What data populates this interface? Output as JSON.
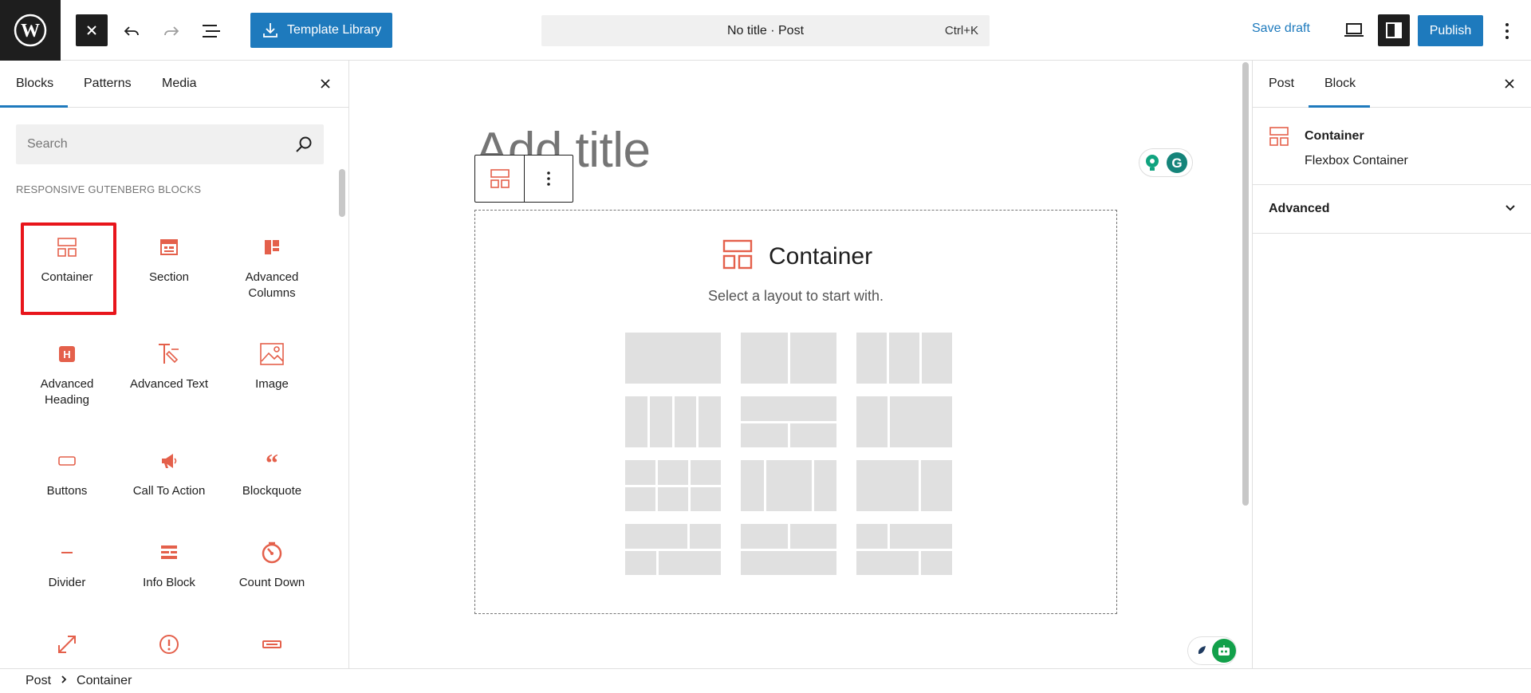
{
  "topbar": {
    "logo_icon": "wordpress-icon",
    "close_icon": "close-icon",
    "undo_icon": "undo-icon",
    "redo_icon": "redo-icon",
    "document_overview_icon": "list-view-icon",
    "template_library_label": "Template Library",
    "command_title": "No title · Post",
    "command_shortcut": "Ctrl+K",
    "save_draft_label": "Save draft",
    "preview_icon": "laptop-icon",
    "settings_icon": "sidebar-toggle-icon",
    "publish_label": "Publish",
    "options_icon": "more-vertical-icon",
    "accent_color": "#1e7abd"
  },
  "inserter": {
    "tabs": [
      {
        "label": "Blocks",
        "active": true
      },
      {
        "label": "Patterns",
        "active": false
      },
      {
        "label": "Media",
        "active": false
      }
    ],
    "search_placeholder": "Search",
    "category_title": "RESPONSIVE GUTENBERG BLOCKS",
    "icon_color": "#e4604b",
    "highlight_color": "#e8151b",
    "blocks": [
      {
        "label": "Container",
        "icon": "container-icon"
      },
      {
        "label": "Section",
        "icon": "section-icon"
      },
      {
        "label": "Advanced Columns",
        "icon": "columns-icon"
      },
      {
        "label": "Advanced Heading",
        "icon": "heading-icon"
      },
      {
        "label": "Advanced Text",
        "icon": "text-icon"
      },
      {
        "label": "Image",
        "icon": "image-icon"
      },
      {
        "label": "Buttons",
        "icon": "button-icon"
      },
      {
        "label": "Call To Action",
        "icon": "megaphone-icon"
      },
      {
        "label": "Blockquote",
        "icon": "quote-icon"
      },
      {
        "label": "Divider",
        "icon": "divider-icon"
      },
      {
        "label": "Info Block",
        "icon": "info-block-icon"
      },
      {
        "label": "Count Down",
        "icon": "countdown-icon"
      },
      {
        "label": "",
        "icon": "resize-icon"
      },
      {
        "label": "",
        "icon": "notice-icon"
      },
      {
        "label": "",
        "icon": "field-icon"
      }
    ]
  },
  "canvas": {
    "title_placeholder": "Add title",
    "container_title": "Container",
    "container_subtitle": "Select a layout to start with.",
    "layout_count": 12
  },
  "settings": {
    "tabs": [
      {
        "label": "Post",
        "active": false
      },
      {
        "label": "Block",
        "active": true
      }
    ],
    "block_title": "Container",
    "block_description": "Flexbox Container",
    "advanced_label": "Advanced"
  },
  "footer": {
    "breadcrumbs": [
      "Post",
      "Container"
    ]
  }
}
